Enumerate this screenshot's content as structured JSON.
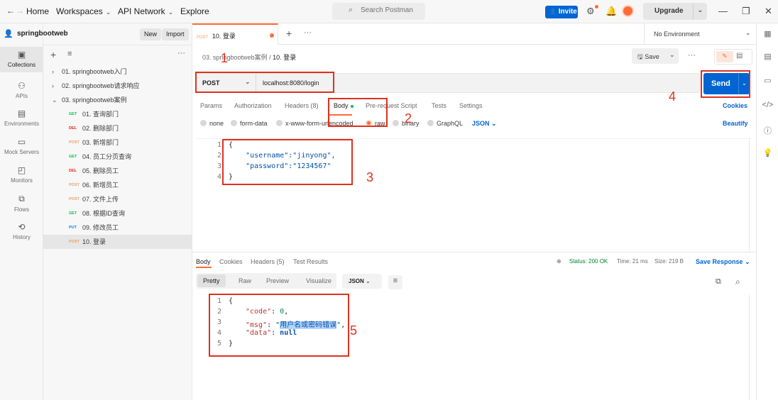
{
  "topbar": {
    "home": "Home",
    "workspaces": "Workspaces",
    "api_network": "API Network",
    "explore": "Explore",
    "search_placeholder": "Search Postman",
    "invite": "Invite",
    "upgrade": "Upgrade"
  },
  "sidebar": {
    "workspace_name": "springbootweb",
    "new_label": "New",
    "import_label": "Import",
    "rail": [
      "Collections",
      "APIs",
      "Environments",
      "Mock Servers",
      "Monitors",
      "Flows",
      "History"
    ]
  },
  "tree": {
    "folders": [
      {
        "name": "01. springbootweb入门",
        "expanded": false
      },
      {
        "name": "02. springbootweb请求响应",
        "expanded": false
      },
      {
        "name": "03. springbootweb案例",
        "expanded": true
      }
    ],
    "requests": [
      {
        "method": "GET",
        "name": "01. 查询部门"
      },
      {
        "method": "DEL",
        "name": "02. 删除部门"
      },
      {
        "method": "POST",
        "name": "03. 新增部门"
      },
      {
        "method": "GET",
        "name": "04. 员工分页查询"
      },
      {
        "method": "DEL",
        "name": "05. 删除员工"
      },
      {
        "method": "POST",
        "name": "06. 新增员工"
      },
      {
        "method": "POST",
        "name": "07. 文件上传"
      },
      {
        "method": "GET",
        "name": "08. 根据ID查询"
      },
      {
        "method": "PUT",
        "name": "09. 修改员工"
      },
      {
        "method": "POST",
        "name": "10. 登录"
      }
    ]
  },
  "tab": {
    "method": "POST",
    "name": "10. 登录",
    "environment": "No Environment"
  },
  "breadcrumb": {
    "folder": "03. springbootweb案例",
    "current": "10. 登录"
  },
  "request": {
    "save_label": "Save",
    "method": "POST",
    "url": "localhost:8080/login",
    "send_label": "Send",
    "tabs": [
      "Params",
      "Authorization",
      "Headers (8)",
      "Body",
      "Pre-request Script",
      "Tests",
      "Settings"
    ],
    "cookies": "Cookies",
    "body_types": [
      "none",
      "form-data",
      "x-www-form-urlencoded",
      "raw",
      "binary",
      "GraphQL"
    ],
    "format": "JSON",
    "beautify": "Beautify",
    "body_lines": [
      "{",
      "    \"username\":\"jinyong\",",
      "    \"password\":\"1234567\"",
      "}"
    ]
  },
  "response": {
    "tabs": [
      "Body",
      "Cookies",
      "Headers (5)",
      "Test Results"
    ],
    "status": "Status: 200 OK",
    "time": "Time: 21 ms",
    "size": "Size: 219 B",
    "save_response": "Save Response",
    "views": [
      "Pretty",
      "Raw",
      "Preview",
      "Visualize"
    ],
    "format": "JSON",
    "line1": "{",
    "code_key": "\"code\"",
    "code_val": "0",
    "msg_key": "\"msg\"",
    "msg_val": "用户名或密码错误",
    "data_key": "\"data\"",
    "data_val": "null",
    "line5": "}"
  },
  "annotations": [
    "1",
    "2",
    "3",
    "4",
    "5"
  ],
  "colors": {
    "accent": "#ff6c37",
    "send": "#0265d2",
    "annotation": "#e0301e"
  }
}
